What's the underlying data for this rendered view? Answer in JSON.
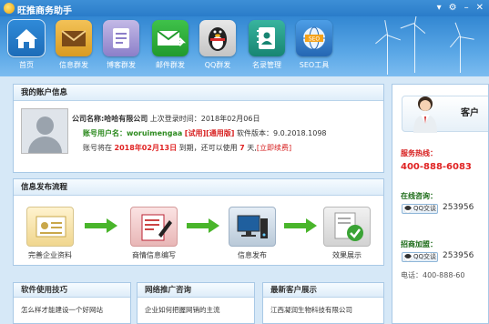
{
  "app": {
    "title": "旺推商务助手",
    "window_buttons": [
      "▾",
      "⚙",
      "–",
      "✕"
    ]
  },
  "toolbar": {
    "items": [
      {
        "label": "首页",
        "icon": "home-icon"
      },
      {
        "label": "信息群发",
        "icon": "envelope-icon"
      },
      {
        "label": "博客群发",
        "icon": "blog-icon"
      },
      {
        "label": "邮件群发",
        "icon": "mail-send-icon"
      },
      {
        "label": "QQ群发",
        "icon": "qq-penguin-icon"
      },
      {
        "label": "名录管理",
        "icon": "contacts-book-icon"
      },
      {
        "label": "SEO工具",
        "icon": "seo-globe-icon"
      }
    ],
    "active": 0
  },
  "account": {
    "heading": "我的账户信息",
    "company_label": "公司名称:",
    "company_name": "哈哈有限公司",
    "last_login_label": "上次登录时间：",
    "last_login": "2018年02月06日",
    "user_label": "账号用户名：",
    "username": "woruimengaa",
    "trial_tag": "[试用]",
    "edition_tag": "[通用版]",
    "version_label": "软件版本：",
    "version": "9.0.2018.1098",
    "expire_prefix": "账号将在",
    "expire_date": "2018年02月13日",
    "expire_mid": "到期，还可以使用",
    "days_left": "7",
    "days_unit": "天,",
    "renew_link": "[立即续费]"
  },
  "workflow": {
    "heading": "信息发布流程",
    "steps": [
      {
        "label": "完善企业资料"
      },
      {
        "label": "商情信息编写"
      },
      {
        "label": "信息发布"
      },
      {
        "label": "效果展示"
      }
    ]
  },
  "tips": {
    "heading": "软件使用技巧",
    "first_item": "怎么样才能建设一个好网站"
  },
  "promo": {
    "heading": "网络推广咨询",
    "first_item": "企业如何把握网销的主流"
  },
  "customers": {
    "heading": "最新客户展示",
    "first_item": "江西凝润生物科技有限公司"
  },
  "support": {
    "heading": "客户",
    "hotline_label": "服务热线：",
    "hotline": "400-888-6083",
    "consult_label": "在线咨询：",
    "consult_qq_tag": "QQ交谈",
    "consult_qq": "253956",
    "join_label": "招商加盟：",
    "join_qq_tag": "QQ交谈",
    "join_qq": "253956",
    "phone_line": "电话：400-888-60"
  }
}
